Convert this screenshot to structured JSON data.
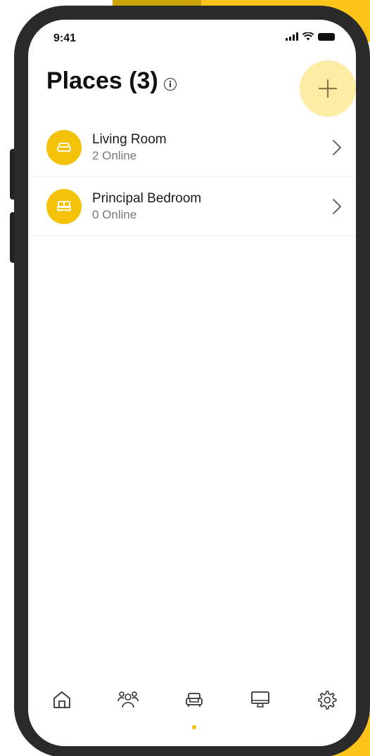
{
  "status_bar": {
    "time": "9:41"
  },
  "header": {
    "title": "Places (3)"
  },
  "places": [
    {
      "name": "Living Room",
      "status": "2 Online",
      "icon": "sofa-icon"
    },
    {
      "name": "Principal Bedroom",
      "status": "0 Online",
      "icon": "bed-icon"
    }
  ],
  "tab_bar": {
    "tabs": [
      {
        "icon": "home-icon",
        "active": false
      },
      {
        "icon": "people-icon",
        "active": false
      },
      {
        "icon": "sofa-icon",
        "active": true
      },
      {
        "icon": "monitor-icon",
        "active": false
      },
      {
        "icon": "gear-icon",
        "active": false
      }
    ]
  },
  "colors": {
    "accent": "#f5c20a",
    "accent_light": "#fdeca3",
    "background_yellow": "#fcc419",
    "phone_frame": "#2a2a2a"
  }
}
